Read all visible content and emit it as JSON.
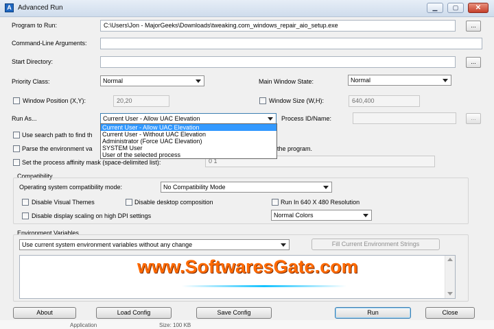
{
  "window": {
    "title": "Advanced Run"
  },
  "fields": {
    "program_to_run": {
      "label": "Program to Run:",
      "value": "C:\\Users\\Jon - MajorGeeks\\Downloads\\tweaking.com_windows_repair_aio_setup.exe"
    },
    "command_line": {
      "label": "Command-Line Arguments:",
      "value": ""
    },
    "start_directory": {
      "label": "Start Directory:",
      "value": ""
    },
    "browse_label": "...",
    "priority_class": {
      "label": "Priority Class:",
      "value": "Normal"
    },
    "main_window_state": {
      "label": "Main Window State:",
      "value": "Normal"
    },
    "window_position": {
      "label": "Window Position (X,Y):",
      "value": "20,20"
    },
    "window_size": {
      "label": "Window Size (W,H):",
      "value": "640,400"
    },
    "run_as": {
      "label": "Run As...",
      "value": "Current User - Allow UAC Elevation"
    },
    "process_id": {
      "label": "Process ID/Name:",
      "value": ""
    }
  },
  "run_as_options": [
    "Current User - Allow UAC Elevation",
    "Current User - Without UAC Elevation",
    "Administrator (Force UAC Elevation)",
    "SYSTEM User",
    "User of the selected process"
  ],
  "run_as_selected_index": 0,
  "options": {
    "use_search_path": "Use search path to find th",
    "parse_env": "Parse the environment va",
    "parse_env_tail": "the program.",
    "affinity": "Set the process affinity mask (space-delimited list):",
    "affinity_value": "0 1"
  },
  "compatibility": {
    "group_label": "Compatibility",
    "os_mode_label": "Operating system compatibility mode:",
    "os_mode_value": "No Compatibility Mode",
    "disable_visual_themes": "Disable Visual Themes",
    "disable_desktop_composition": "Disable desktop composition",
    "run_640x480": "Run In 640 X 480 Resolution",
    "disable_dpi_scaling": "Disable display scaling on high DPI settings",
    "colors_value": "Normal Colors"
  },
  "environment": {
    "group_label": "Environment Variables",
    "mode_value": "Use current system environment variables without any change",
    "fill_button": "Fill Current Environment Strings"
  },
  "buttons": {
    "about": "About",
    "load_config": "Load Config",
    "save_config": "Save Config",
    "run": "Run",
    "close": "Close"
  },
  "watermark": "www.SoftwaresGate.com",
  "taskbar": {
    "item1": "Application",
    "item2": "Size: 100 KB"
  },
  "colors": {
    "accent": "#3399ff",
    "title_gradient_top": "#e7eef7",
    "close_button": "#c5402b",
    "watermark": "#ff6a00"
  },
  "icons": {
    "title": "app-icon",
    "minimize": "minimize-icon",
    "maximize": "maximize-icon",
    "close": "close-icon"
  }
}
